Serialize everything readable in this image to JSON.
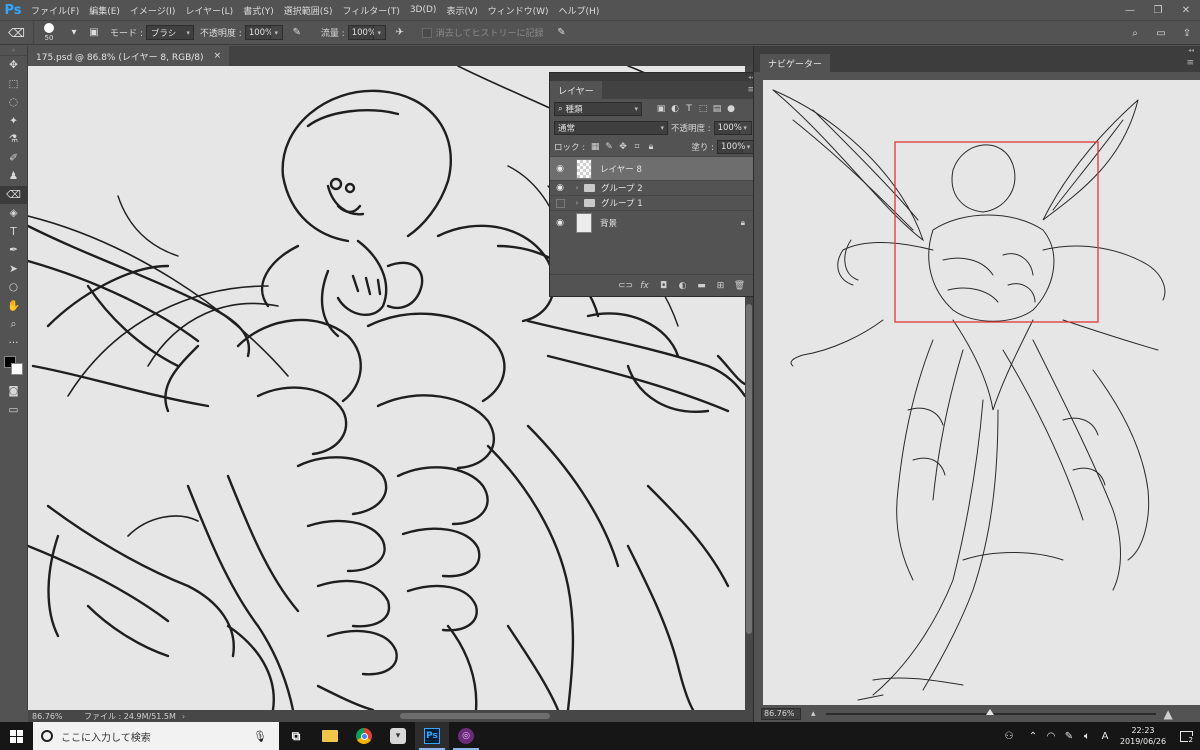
{
  "app": {
    "logo": "Ps"
  },
  "menu": [
    "ファイル(F)",
    "編集(E)",
    "イメージ(I)",
    "レイヤー(L)",
    "書式(Y)",
    "選択範囲(S)",
    "フィルター(T)",
    "3D(D)",
    "表示(V)",
    "ウィンドウ(W)",
    "ヘルプ(H)"
  ],
  "window_controls": [
    "—",
    "❐",
    "✕"
  ],
  "options": {
    "tool_icon": "eraser-icon",
    "brush_size": "50",
    "mode_label": "モード :",
    "mode_value": "ブラシ",
    "opacity_label": "不透明度 :",
    "opacity_value": "100%",
    "flow_label": "流量 :",
    "flow_value": "100%",
    "erase_history_label": "消去してヒストリーに記録"
  },
  "tools": [
    "move-tool",
    "marquee-tool",
    "lasso-tool",
    "magic-wand-tool",
    "eyedropper-tool",
    "brush-tool",
    "stamp-tool",
    "eraser-tool",
    "bucket-tool",
    "type-tool",
    "pen-tool",
    "path-select-tool",
    "ellipse-tool",
    "hand-tool",
    "zoom-tool",
    "more-tools"
  ],
  "document": {
    "tab_title": "175.psd @ 86.8% (レイヤー 8, RGB/8)",
    "tab_close": "×",
    "zoom": "86.76%",
    "file_info": "ファイル : 24.9M/51.5M"
  },
  "layers_panel": {
    "tab": "レイヤー",
    "filter_label": "種類",
    "blend_mode": "通常",
    "opacity_label": "不透明度 :",
    "opacity_value": "100%",
    "lock_label": "ロック :",
    "fill_label": "塗り :",
    "fill_value": "100%",
    "layers": [
      {
        "name": "レイヤー 8",
        "visible": true,
        "selected": true,
        "kind": "pixel"
      },
      {
        "name": "グループ 2",
        "visible": true,
        "selected": false,
        "kind": "group"
      },
      {
        "name": "グループ 1",
        "visible": false,
        "selected": false,
        "kind": "group"
      },
      {
        "name": "背景",
        "visible": true,
        "selected": false,
        "kind": "background",
        "locked": true
      }
    ],
    "bottom_icons": [
      "link-icon",
      "fx-icon",
      "mask-icon",
      "adjustment-icon",
      "folder-icon",
      "new-layer-icon",
      "trash-icon"
    ]
  },
  "navigator": {
    "tab": "ナビゲーター",
    "zoom": "86.76%",
    "view_box_color": "#e0383a"
  },
  "taskbar": {
    "search_placeholder": "ここに入力して検索",
    "time": "22:23",
    "date": "2019/06/26",
    "ime": "A",
    "notifications": "2"
  }
}
